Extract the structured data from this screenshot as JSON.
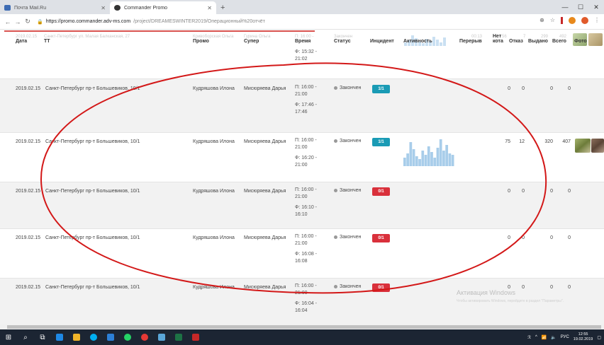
{
  "browser": {
    "tabs": [
      {
        "title": "Почта Mail.Ru",
        "active": false,
        "favicon_color": "#3d6bb3"
      },
      {
        "title": "Commander Promo",
        "active": true,
        "favicon_color": "#333333"
      }
    ],
    "new_tab": "+",
    "url_host": "https://promo.commander.adv-ms.com",
    "url_path": "/project/DREAMESWINTER2019/Операционный%20отчёт"
  },
  "ghost_row": {
    "date": "2019.02.15",
    "tt": "Санкт-Петербург ул. Малая Балканская, 27",
    "promo": "Кривоборская Ольга",
    "super": "Гурина Ольга",
    "time": "П: 16:00 -",
    "status": "Закончен",
    "break": "00:13",
    "net": "56",
    "refuse": "7",
    "given": "299",
    "total": "492"
  },
  "columns": [
    "Дата",
    "ТТ",
    "Промо",
    "Супер",
    "Время",
    "Статус",
    "Инцидент",
    "Активность",
    "Перерыв",
    "Нет",
    "кота",
    "Отказ",
    "Выдано",
    "Всего",
    "Фото"
  ],
  "top_time": [
    "Ф: 15:32 -",
    "21:02"
  ],
  "rows": [
    {
      "date": "2019.02.15",
      "tt": "Санкт-Петербург пр-т Большевиков, 10/1",
      "promo": "Кудряшова Илона",
      "super": "Мисюряева Дарья",
      "time": [
        "П: 16:00 -",
        "21:00",
        "Ф: 17:46 -",
        "17:46"
      ],
      "status": "Закончен",
      "incident": "1/1",
      "incident_color": "teal",
      "kota": "0",
      "refuse": "0",
      "given": "0",
      "total": "0"
    },
    {
      "date": "2019.02.15",
      "tt": "Санкт-Петербург пр-т Большевиков, 10/1",
      "promo": "Кудряшова Илона",
      "super": "Мисюряева Дарья",
      "time": [
        "П: 16:00 -",
        "21:00",
        "Ф: 16:20 -",
        "21:00"
      ],
      "status": "Закончен",
      "incident": "1/1",
      "incident_color": "teal",
      "kota": "75",
      "refuse": "12",
      "given": "320",
      "total": "407"
    },
    {
      "date": "2019.02.15",
      "tt": "Санкт-Петербург пр-т Большевиков, 10/1",
      "promo": "Кудряшова Илона",
      "super": "Мисюряева Дарья",
      "time": [
        "П: 16:00 -",
        "21:00",
        "Ф: 16:10 -",
        "16:10"
      ],
      "status": "Закончен",
      "incident": "0/1",
      "incident_color": "red",
      "kota": "0",
      "refuse": "0",
      "given": "0",
      "total": "0"
    },
    {
      "date": "2019.02.15",
      "tt": "Санкт-Петербург пр-т Большевиков, 10/1",
      "promo": "Кудряшова Илона",
      "super": "Мисюряева Дарья",
      "time": [
        "П: 16:00 -",
        "21:00",
        "Ф: 16:08 -",
        "16:08"
      ],
      "status": "Закончен",
      "incident": "0/1",
      "incident_color": "red",
      "kota": "0",
      "refuse": "0",
      "given": "0",
      "total": "0"
    },
    {
      "date": "2019.02.15",
      "tt": "Санкт-Петербург пр-т Большевиков, 10/1",
      "promo": "Кудряшова Илона",
      "super": "Мисюряева Дарья",
      "time": [
        "П: 16:00 -",
        "21:00",
        "Ф: 16:04 -",
        "16:04"
      ],
      "status": "Закончен",
      "incident": "0/1",
      "incident_color": "red",
      "kota": "0",
      "refuse": "0",
      "given": "0",
      "total": "0"
    }
  ],
  "activity_chart": [
    0.3,
    0.45,
    0.85,
    0.6,
    0.35,
    0.25,
    0.55,
    0.4,
    0.7,
    0.5,
    0.3,
    0.65,
    0.95,
    0.55,
    0.75,
    0.45,
    0.4
  ],
  "windows_activation": {
    "title": "Активация Windows",
    "text": "Чтобы активировать Windows, перейдите в раздел \"Параметры\"."
  },
  "taskbar": {
    "lang": "РУС",
    "time": "12:55",
    "date": "19.02.2019"
  },
  "colors": {
    "teal": "#1a9bb5",
    "red": "#d9303b",
    "annotation": "#d31818"
  }
}
